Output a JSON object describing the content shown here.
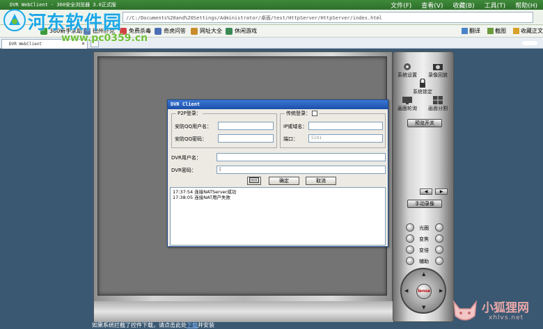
{
  "browser": {
    "title": "DVR WebClient - 360安全浏览器 3.0正式版",
    "menu": [
      "文件(F)",
      "查看(V)",
      "收藏(B)",
      "工具(T)",
      "帮助(H)"
    ],
    "address": "file:///C:/Documents%20and%20Settings/Administrator/桌面/test/HttpServer/HttpServer/index.htm",
    "address_visible": "//C:/Documents%20and%20Settings/Administrator/桌面/test/HttpServer/HttpServer/index.html"
  },
  "bookmarks": {
    "items": [
      {
        "label": "360新手求助",
        "icon": "360-icon",
        "color": "#3c9a3c"
      },
      {
        "label": "德州扑克",
        "icon": "poker-icon",
        "color": "#5a7fb0"
      },
      {
        "label": "免费杀毒",
        "icon": "shield-icon",
        "color": "#d04040"
      },
      {
        "label": "奇虎问答",
        "icon": "qa-icon",
        "color": "#4a6fb5"
      },
      {
        "label": "网址大全",
        "icon": "web-icon",
        "color": "#c88c2a"
      },
      {
        "label": "休闲游戏",
        "icon": "game-icon",
        "color": "#3b8a55"
      }
    ],
    "right": [
      {
        "label": "翻译",
        "icon": "translate-icon"
      },
      {
        "label": "截图",
        "icon": "screenshot-icon"
      },
      {
        "label": "收藏正文",
        "icon": "favorites-icon"
      }
    ]
  },
  "tab": {
    "label": "DVR WebClient"
  },
  "watermark": {
    "site_name": "河东软件园",
    "url": "www.pc0359.cn",
    "corner_name": "小狐狸网",
    "corner_sub": "xhlvs.net"
  },
  "controls": {
    "system_settings": "系统设置",
    "record_video": "录像回放",
    "system_lock": "系统锁定",
    "picture_poll": "画面轮询",
    "picture_split": "画面分割",
    "preview_toggle": "预览开关",
    "manual_record": "手动录像",
    "aperture": "光圈",
    "focus": "变焦",
    "zoom": "变倍",
    "aux": "辅助",
    "dpad_center": "lense"
  },
  "dialog": {
    "title": "DVR Client",
    "p2p_group": "P2P登录：",
    "qq_user_label": "安防QQ用户名：",
    "qq_pass_label": "安防QQ密码：",
    "traditional_group": "传统登录：",
    "ip_label": "IP或域名：",
    "port_label": "端口：",
    "port_value": "5191",
    "dvr_user_label": "DVR用户名：",
    "dvr_pass_label": "DVR密码：",
    "ok_button": "确定",
    "cancel_button": "取消",
    "log": [
      "17:37:54   连接NATServer成功",
      "17:38:05   连接NAT用户失败"
    ]
  },
  "status": {
    "text_before": "如果系统拦截了控件下载，请点击此处",
    "link": "下载",
    "text_after": "并安装"
  }
}
